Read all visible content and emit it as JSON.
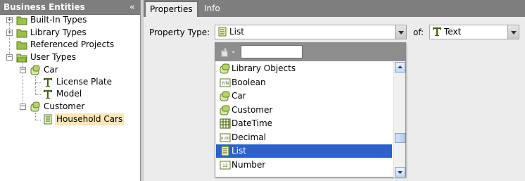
{
  "left_panel": {
    "title": "Business Entities",
    "collapse_glyph": "«",
    "tree": {
      "built_in_types": "Built-In Types",
      "library_types": "Library Types",
      "referenced_projects": "Referenced Projects",
      "user_types": "User Types",
      "car": "Car",
      "license_plate": "License Plate",
      "model": "Model",
      "customer": "Customer",
      "household_cars": "Household Cars"
    },
    "expanded_glyph": "−",
    "collapsed_glyph": "+"
  },
  "tabs": {
    "properties": "Properties",
    "info": "Info"
  },
  "form": {
    "property_type_label": "Property Type:",
    "property_type_value": "List",
    "of_label": "of:",
    "of_value": "Text"
  },
  "dropdown": {
    "search_value": "",
    "items": [
      {
        "label": "Library Objects",
        "icon": "entity-icon"
      },
      {
        "label": "Boolean",
        "icon": "boolean-icon"
      },
      {
        "label": "Car",
        "icon": "entity-icon"
      },
      {
        "label": "Customer",
        "icon": "entity-icon"
      },
      {
        "label": "DateTime",
        "icon": "datetime-icon"
      },
      {
        "label": "Decimal",
        "icon": "decimal-icon"
      },
      {
        "label": "List",
        "icon": "list-icon"
      },
      {
        "label": "Number",
        "icon": "number-icon"
      }
    ],
    "selected": "List",
    "scroll_position": 0.72
  },
  "colors": {
    "header_gray": "#7e7e7e",
    "selection_blue": "#2c62c8",
    "tree_highlight": "#fde7b5",
    "folder_olive": "#9bbf4a"
  }
}
